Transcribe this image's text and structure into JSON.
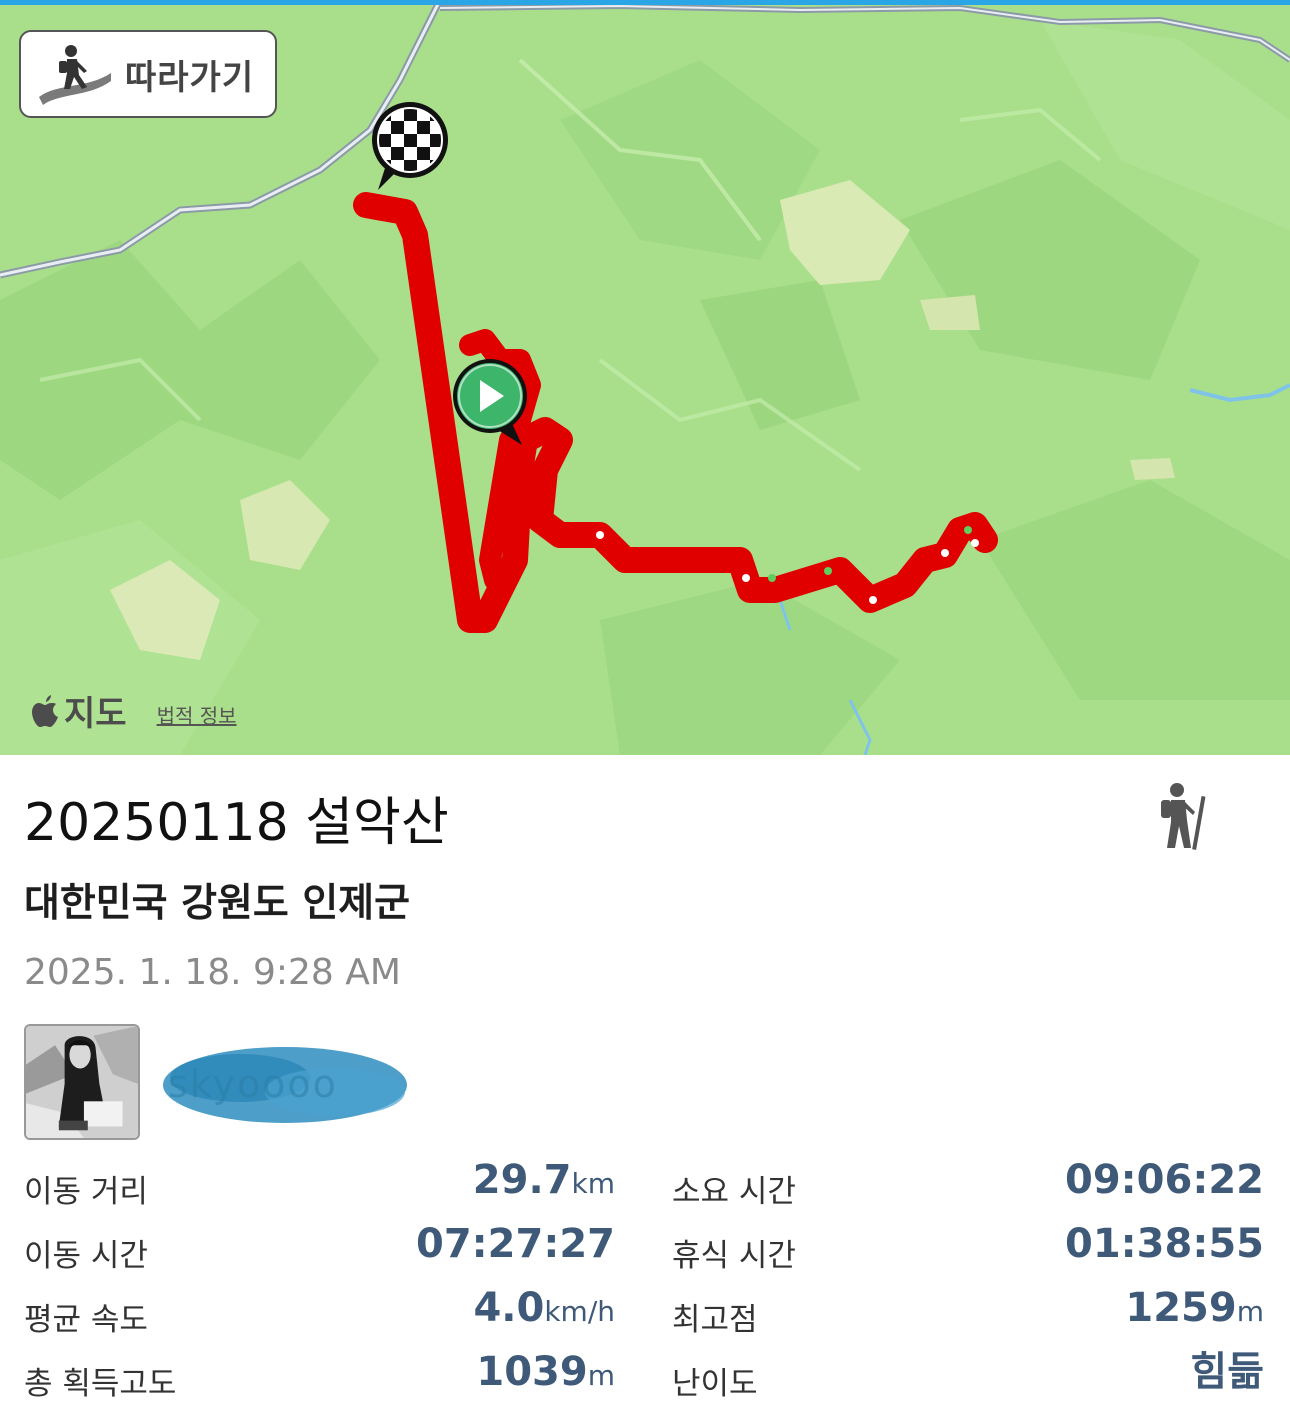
{
  "map": {
    "follow_button_label": "따라가기",
    "brand_label": "지도",
    "legal_link": "법적 정보"
  },
  "activity": {
    "title": "20250118 설악산",
    "location": "대한민국 강원도 인제군",
    "datetime": "2025. 1. 18. 9:28 AM",
    "username": "skyoooo",
    "activity_type_icon": "hiker-icon"
  },
  "stats": {
    "distance": {
      "label": "이동 거리",
      "value": "29.7",
      "unit": "km"
    },
    "moving_time": {
      "label": "이동 시간",
      "value": "07:27:27",
      "unit": ""
    },
    "avg_speed": {
      "label": "평균 속도",
      "value": "4.0",
      "unit": "km/h"
    },
    "elev_gain": {
      "label": "총 획득고도",
      "value": "1039",
      "unit": "m"
    },
    "total_time": {
      "label": "소요 시간",
      "value": "09:06:22",
      "unit": ""
    },
    "rest_time": {
      "label": "휴식 시간",
      "value": "01:38:55",
      "unit": ""
    },
    "max_elevation": {
      "label": "최고점",
      "value": "1259",
      "unit": "m"
    },
    "difficulty": {
      "label": "난이도",
      "value": "힘듦",
      "unit": ""
    }
  },
  "colors": {
    "route": "#e00000",
    "stat_value": "#3f5a78",
    "map_green": "#a9df8a",
    "start_marker": "#3db56a"
  }
}
